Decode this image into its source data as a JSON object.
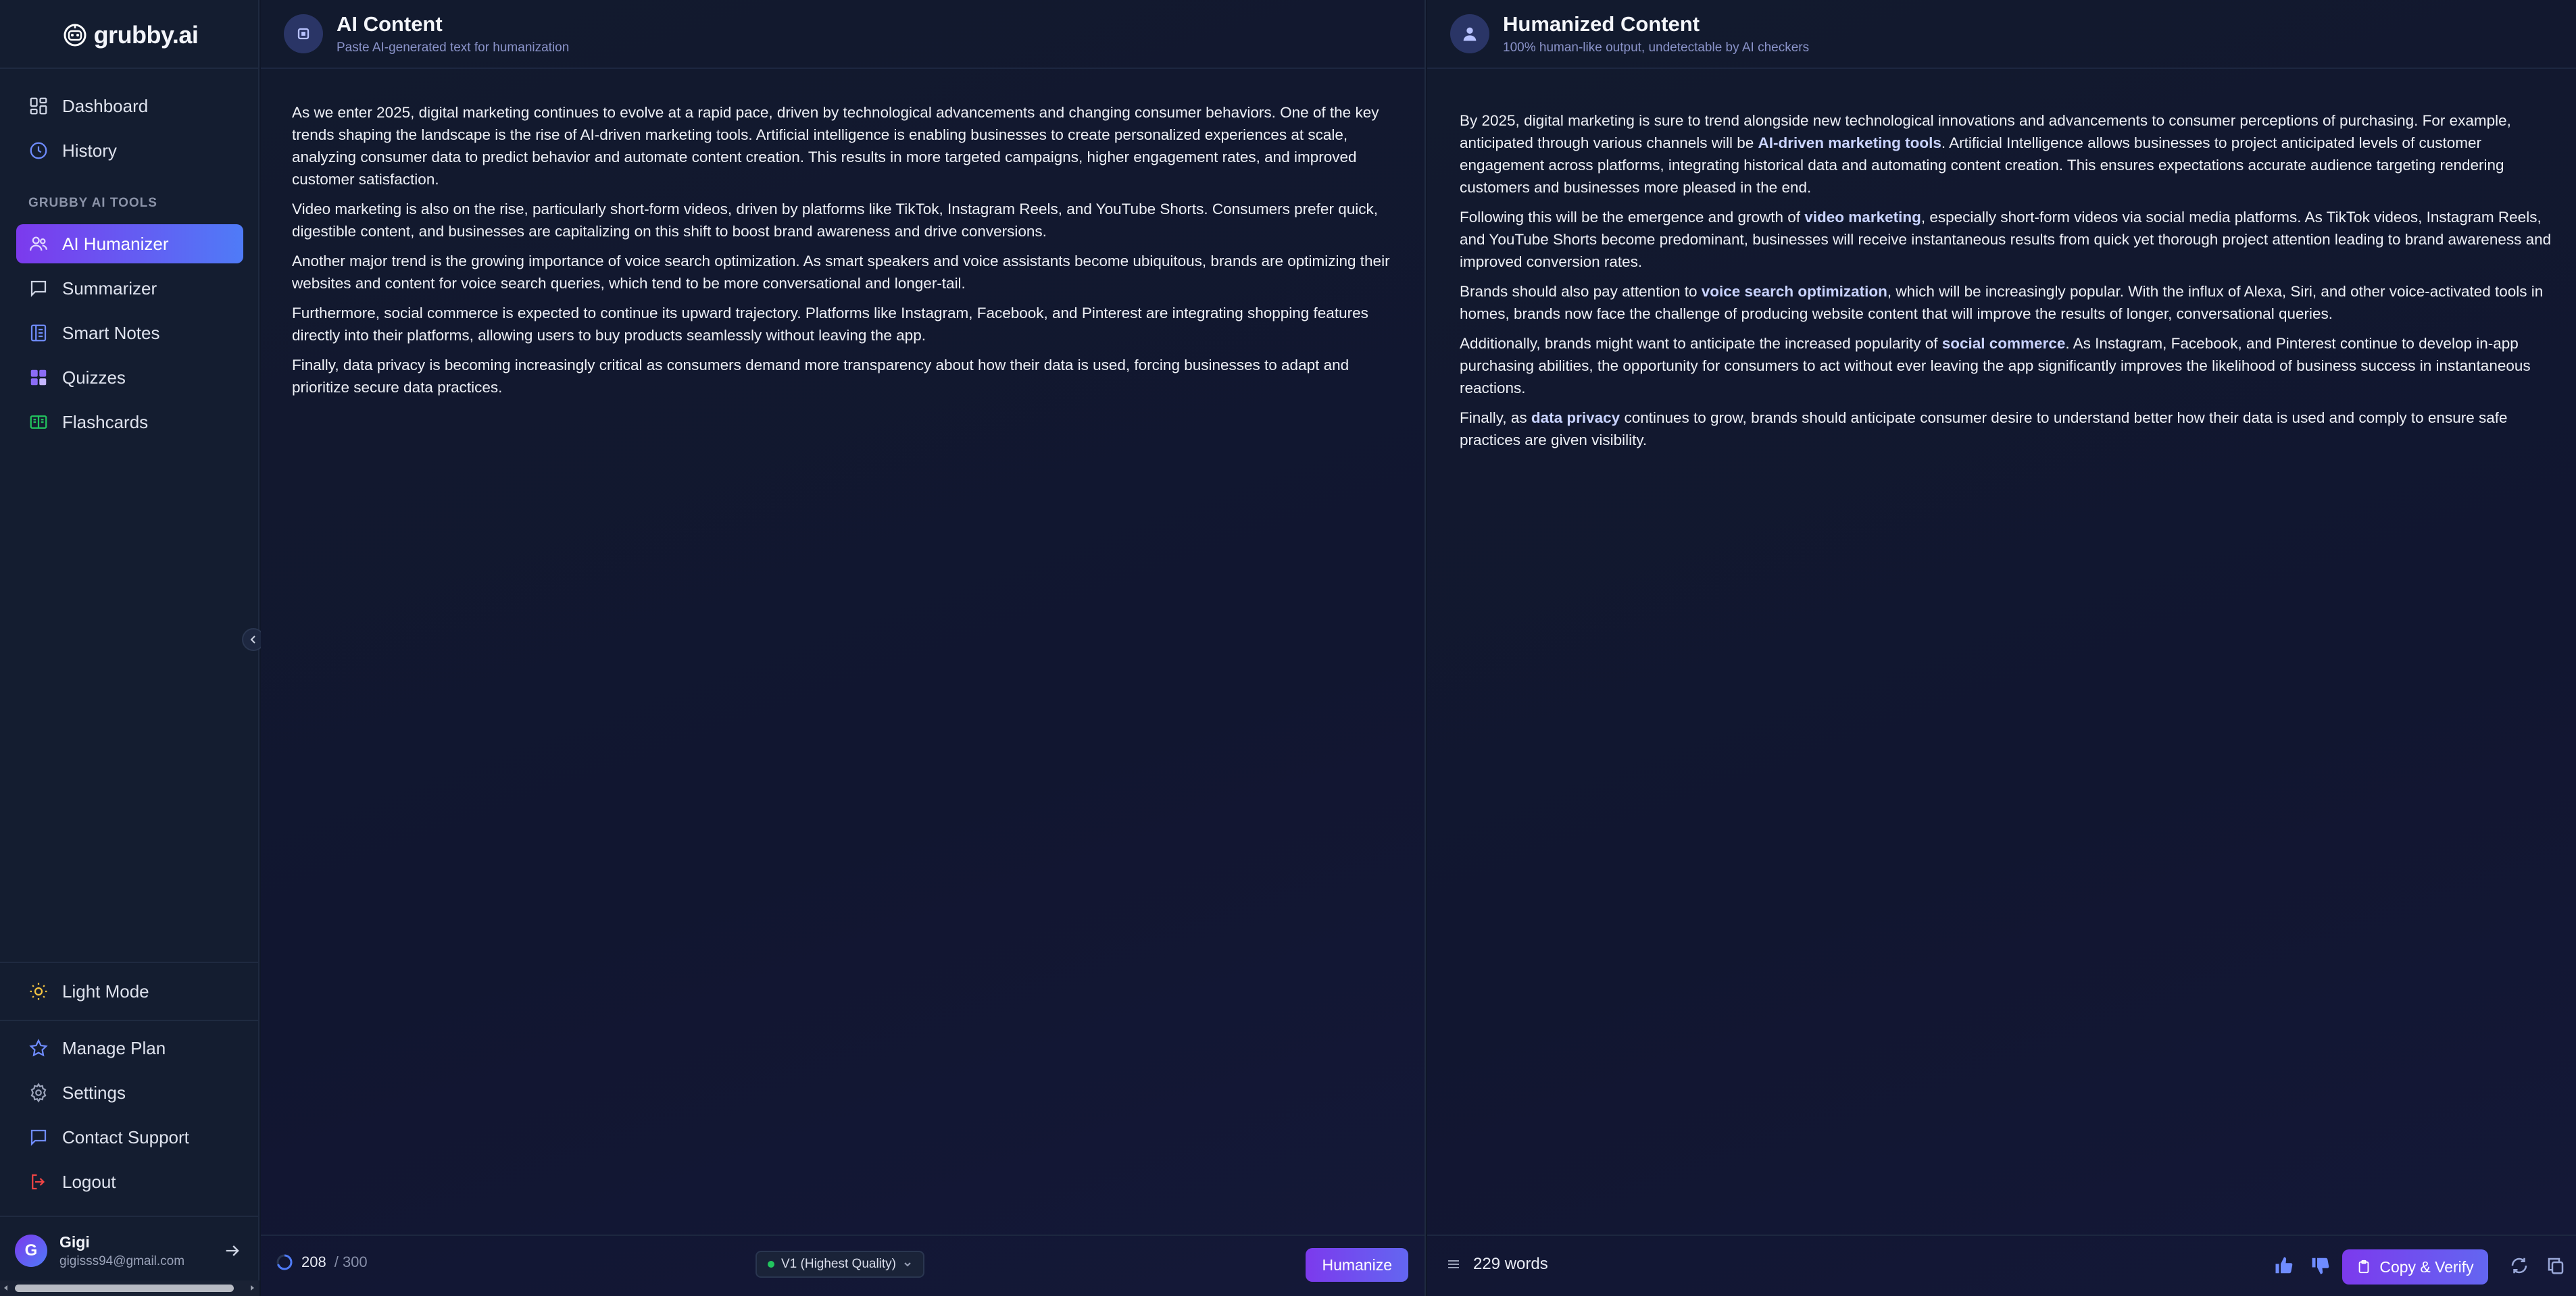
{
  "app": {
    "logo_text": "grubby.ai"
  },
  "sidebar": {
    "top_items": [
      {
        "label": "Dashboard",
        "icon": "dashboard-icon"
      },
      {
        "label": "History",
        "icon": "clock-icon"
      }
    ],
    "section_label": "GRUBBY AI TOOLS",
    "tools": [
      {
        "label": "AI Humanizer",
        "icon": "users-icon",
        "active": true
      },
      {
        "label": "Summarizer",
        "icon": "message-icon"
      },
      {
        "label": "Smart Notes",
        "icon": "notebook-icon"
      },
      {
        "label": "Quizzes",
        "icon": "puzzle-icon"
      },
      {
        "label": "Flashcards",
        "icon": "cards-icon"
      }
    ],
    "bottom_items": [
      {
        "label": "Light Mode",
        "icon": "sun-icon"
      },
      {
        "label": "Manage Plan",
        "icon": "star-icon"
      },
      {
        "label": "Settings",
        "icon": "gear-icon"
      },
      {
        "label": "Contact Support",
        "icon": "chat-icon"
      },
      {
        "label": "Logout",
        "icon": "logout-icon"
      }
    ],
    "user": {
      "initial": "G",
      "name": "Gigi",
      "email": "gigisss94@gmail.com"
    }
  },
  "left_panel": {
    "title": "AI Content",
    "subtitle": "Paste AI-generated text for humanization",
    "paragraphs": [
      "As we enter 2025, digital marketing continues to evolve at a rapid pace, driven by technological advancements and changing consumer behaviors. One of the key trends shaping the landscape is the rise of AI-driven marketing tools. Artificial intelligence is enabling businesses to create personalized experiences at scale, analyzing consumer data to predict behavior and automate content creation. This results in more targeted campaigns, higher engagement rates, and improved customer satisfaction.",
      "Video marketing is also on the rise, particularly short-form videos, driven by platforms like TikTok, Instagram Reels, and YouTube Shorts. Consumers prefer quick, digestible content, and businesses are capitalizing on this shift to boost brand awareness and drive conversions.",
      "Another major trend is the growing importance of voice search optimization. As smart speakers and voice assistants become ubiquitous, brands are optimizing their websites and content for voice search queries, which tend to be more conversational and longer-tail.",
      "Furthermore, social commerce is expected to continue its upward trajectory. Platforms like Instagram, Facebook, and Pinterest are integrating shopping features directly into their platforms, allowing users to buy products seamlessly without leaving the app.",
      "Finally, data privacy is becoming increasingly critical as consumers demand more transparency about how their data is used, forcing businesses to adapt and prioritize secure data practices."
    ],
    "word_count": "208",
    "word_limit": "/ 300",
    "mode": "V1 (Highest Quality)",
    "humanize_label": "Humanize"
  },
  "right_panel": {
    "title": "Humanized Content",
    "subtitle": "100% human-like output, undetectable by AI checkers",
    "paragraphs": [
      [
        {
          "t": "By 2025, digital marketing is sure to trend alongside new technological innovations and advancements to consumer perceptions of purchasing. For example, anticipated through various channels will be "
        },
        {
          "t": "AI-driven marketing tools",
          "b": true
        },
        {
          "t": ". Artificial Intelligence allows businesses to project anticipated levels of customer engagement across platforms, integrating historical data and automating content creation. This ensures expectations accurate audience targeting rendering customers and businesses more pleased in the end."
        }
      ],
      [
        {
          "t": "Following this will be the emergence and growth of "
        },
        {
          "t": "video marketing",
          "b": true
        },
        {
          "t": ", especially short-form videos via social media platforms. As TikTok videos, Instagram Reels, and YouTube Shorts become predominant, businesses will receive instantaneous results from quick yet thorough project attention leading to brand awareness and improved conversion rates."
        }
      ],
      [
        {
          "t": "Brands should also pay attention to "
        },
        {
          "t": "voice search optimization",
          "b": true
        },
        {
          "t": ", which will be increasingly popular. With the influx of Alexa, Siri, and other voice-activated tools in homes, brands now face the challenge of producing website content that will improve the results of longer, conversational queries."
        }
      ],
      [
        {
          "t": "Additionally, brands might want to anticipate the increased popularity of "
        },
        {
          "t": "social commerce",
          "b": true
        },
        {
          "t": ". As Instagram, Facebook, and Pinterest continue to develop in-app purchasing abilities, the opportunity for consumers to act without ever leaving the app significantly improves the likelihood of business success in instantaneous reactions."
        }
      ],
      [
        {
          "t": "Finally, as "
        },
        {
          "t": "data privacy",
          "b": true
        },
        {
          "t": " continues to grow, brands should anticipate consumer desire to understand better how their data is used and comply to ensure safe practices are given visibility."
        }
      ]
    ],
    "word_count_label": "229 words",
    "copy_label": "Copy & Verify"
  },
  "colors": {
    "accent_purple": "#7c3aed",
    "accent_blue": "#4f7bf7",
    "background": "#0f1628",
    "sidebar": "#141d30"
  }
}
